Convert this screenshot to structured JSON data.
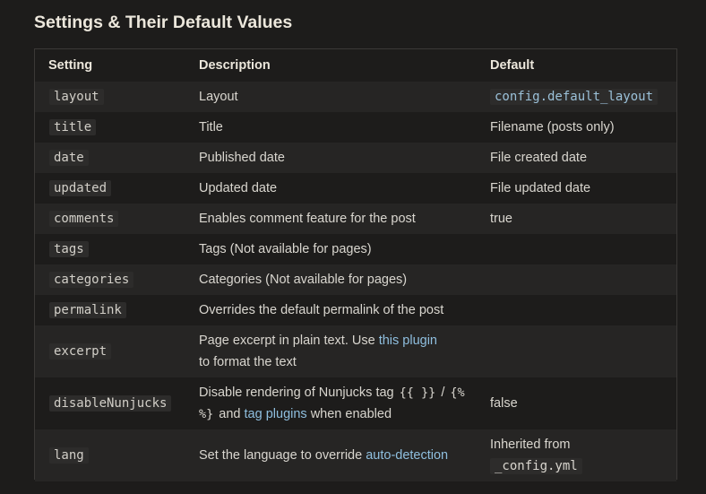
{
  "title": "Settings & Their Default Values",
  "headers": {
    "setting": "Setting",
    "description": "Description",
    "default": "Default"
  },
  "rows": [
    {
      "setting": "layout",
      "description": "Layout",
      "default": "config.default_layout"
    },
    {
      "setting": "title",
      "description": "Title",
      "default": "Filename (posts only)"
    },
    {
      "setting": "date",
      "description": "Published date",
      "default": "File created date"
    },
    {
      "setting": "updated",
      "description": "Updated date",
      "default": "File updated date"
    },
    {
      "setting": "comments",
      "description": "Enables comment feature for the post",
      "default": "true"
    },
    {
      "setting": "tags",
      "description": "Tags (Not available for pages)",
      "default": ""
    },
    {
      "setting": "categories",
      "description": "Categories (Not available for pages)",
      "default": ""
    },
    {
      "setting": "permalink",
      "description": "Overrides the default permalink of the post",
      "default": ""
    },
    {
      "setting": "excerpt",
      "description_before": "Page excerpt in plain text. Use",
      "description_link": "this plugin",
      "description_after": "to format the text",
      "default": ""
    },
    {
      "setting": "disableNunjucks",
      "description_before": "Disable rendering of Nunjucks tag",
      "code_1": "{{ }}",
      "separator": "/",
      "code_2": "{% %}",
      "description_mid": "and",
      "description_link": "tag plugins",
      "description_after": "when enabled",
      "default": "false"
    },
    {
      "setting": "lang",
      "description_before": "Set the language to override",
      "description_link": "auto-detection",
      "default_text": "Inherited from",
      "default_code": "_config.yml"
    }
  ]
}
